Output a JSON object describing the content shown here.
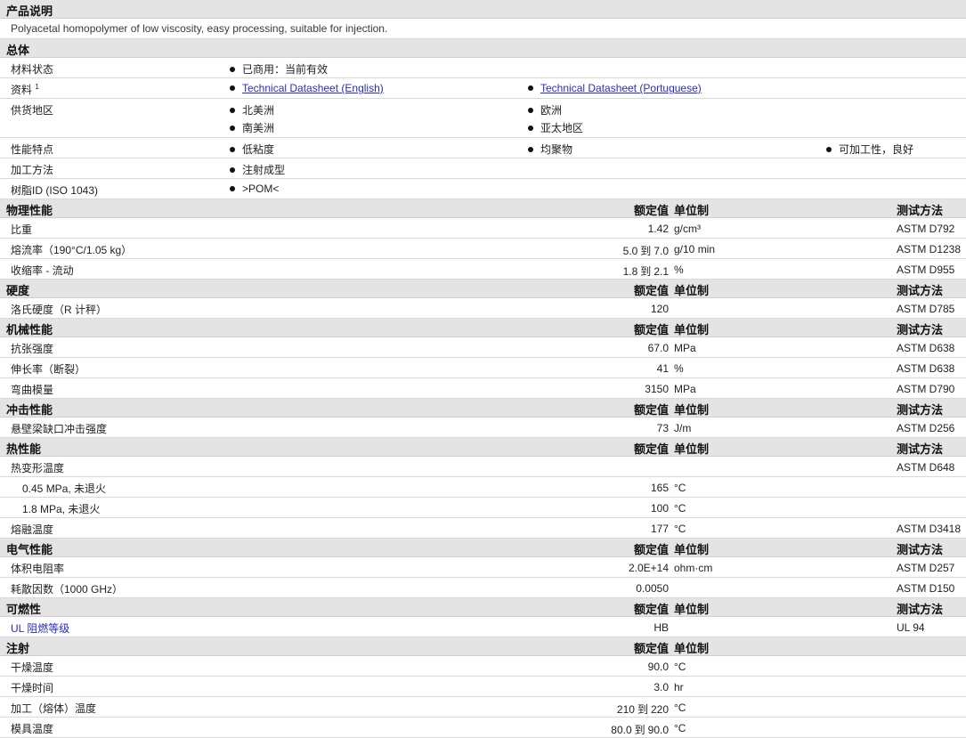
{
  "product": {
    "header": "产品说明",
    "description": "Polyacetal homopolymer of low viscosity, easy processing, suitable for injection."
  },
  "general": {
    "header": "总体",
    "status_label": "材料状态",
    "status_value": "已商用：当前有效",
    "docs_label": "资料",
    "docs_sup": "1",
    "doc_links": [
      "Technical Datasheet (English)",
      "Technical Datasheet (Portuguese)"
    ],
    "supply_label": "供货地区",
    "regions": [
      "北美洲",
      "欧洲",
      "南美洲",
      "亚太地区"
    ],
    "features_label": "性能特点",
    "features": [
      "低粘度",
      "均聚物",
      "可加工性，良好"
    ],
    "process_label": "加工方法",
    "process_value": "注射成型",
    "resin_label": "树脂ID (ISO 1043)",
    "resin_value": ">POM<"
  },
  "col_headers": {
    "nominal": "额定值",
    "unit": "单位制",
    "method": "测试方法"
  },
  "sections": {
    "physical": {
      "title": "物理性能",
      "rows": [
        {
          "label": "比重",
          "value": "1.42",
          "unit": "g/cm³",
          "method": "ASTM D792"
        },
        {
          "label": "熔流率（190°C/1.05 kg）",
          "v1": "5.0",
          "to": "到",
          "v2": "7.0",
          "unit": "g/10 min",
          "method": "ASTM D1238"
        },
        {
          "label": "收缩率 - 流动",
          "v1": "1.8",
          "to": "到",
          "v2": "2.1",
          "unit": "%",
          "method": "ASTM D955"
        }
      ]
    },
    "hardness": {
      "title": "硬度",
      "rows": [
        {
          "label": "洛氏硬度（R 计秤）",
          "value": "120",
          "unit": "",
          "method": "ASTM D785"
        }
      ]
    },
    "mechanical": {
      "title": "机械性能",
      "rows": [
        {
          "label": "抗张强度",
          "value": "67.0",
          "unit": "MPa",
          "method": "ASTM D638"
        },
        {
          "label": "伸长率（断裂）",
          "value": "41",
          "unit": "%",
          "method": "ASTM D638"
        },
        {
          "label": "弯曲模量",
          "value": "3150",
          "unit": "MPa",
          "method": "ASTM D790"
        }
      ]
    },
    "impact": {
      "title": "冲击性能",
      "rows": [
        {
          "label": "悬壁梁缺口冲击强度",
          "value": "73",
          "unit": "J/m",
          "method": "ASTM D256"
        }
      ]
    },
    "thermal": {
      "title": "热性能",
      "rows": [
        {
          "label": "热变形温度",
          "value": "",
          "unit": "",
          "method": "ASTM D648"
        },
        {
          "label": "0.45 MPa, 未退火",
          "value": "165",
          "unit": "°C",
          "method": ""
        },
        {
          "label": "1.8 MPa, 未退火",
          "value": "100",
          "unit": "°C",
          "method": ""
        },
        {
          "label": "熔融温度",
          "value": "177",
          "unit": "°C",
          "method": "ASTM D3418"
        }
      ]
    },
    "electrical": {
      "title": "电气性能",
      "rows": [
        {
          "label": "体积电阻率",
          "value": "2.0E+14",
          "unit": "ohm·cm",
          "method": "ASTM D257"
        },
        {
          "label": "耗散因数（1000 GHz）",
          "value": "0.0050",
          "unit": "",
          "method": "ASTM D150"
        }
      ]
    },
    "flammability": {
      "title": "可燃性",
      "rows": [
        {
          "label": "UL 阻燃等级",
          "value": "HB",
          "unit": "",
          "method": "UL 94"
        }
      ]
    },
    "injection": {
      "title": "注射",
      "rows": [
        {
          "label": "干燥温度",
          "value": "90.0",
          "unit": "°C"
        },
        {
          "label": "干燥时间",
          "value": "3.0",
          "unit": "hr"
        },
        {
          "label": "加工（熔体）温度",
          "v1": "210",
          "to": "到",
          "v2": "220",
          "unit": "°C"
        },
        {
          "label": "模具温度",
          "v1": "80.0",
          "to": "到",
          "v2": "90.0",
          "unit": "°C"
        }
      ]
    }
  }
}
